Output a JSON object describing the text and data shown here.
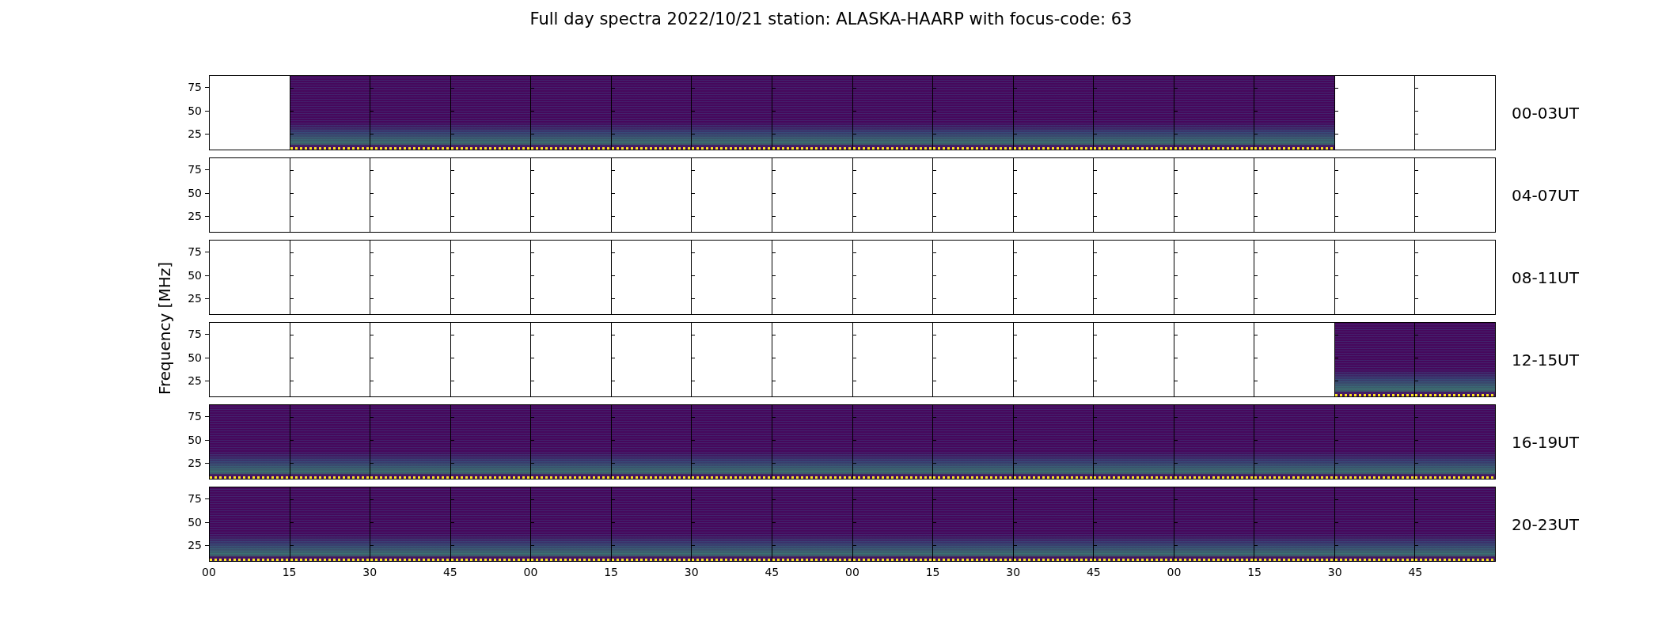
{
  "title": "Full day spectra 2022/10/21 station: ALASKA-HAARP with focus-code: 63",
  "ylabel": "Frequency [MHz]",
  "rows": [
    {
      "label": "00-03UT",
      "yticks": [
        "75",
        "50",
        "25"
      ],
      "panels": [
        false,
        true,
        true,
        true,
        true,
        true,
        true,
        true,
        true,
        true,
        true,
        true,
        true,
        true,
        false,
        false
      ]
    },
    {
      "label": "04-07UT",
      "yticks": [
        "75",
        "50",
        "25"
      ],
      "panels": [
        false,
        false,
        false,
        false,
        false,
        false,
        false,
        false,
        false,
        false,
        false,
        false,
        false,
        false,
        false,
        false
      ]
    },
    {
      "label": "08-11UT",
      "yticks": [
        "75",
        "50",
        "25"
      ],
      "panels": [
        false,
        false,
        false,
        false,
        false,
        false,
        false,
        false,
        false,
        false,
        false,
        false,
        false,
        false,
        false,
        false
      ]
    },
    {
      "label": "12-15UT",
      "yticks": [
        "75",
        "50",
        "25"
      ],
      "panels": [
        false,
        false,
        false,
        false,
        false,
        false,
        false,
        false,
        false,
        false,
        false,
        false,
        false,
        false,
        true,
        true
      ]
    },
    {
      "label": "16-19UT",
      "yticks": [
        "75",
        "50",
        "25"
      ],
      "panels": [
        true,
        true,
        true,
        true,
        true,
        true,
        true,
        true,
        true,
        true,
        true,
        true,
        true,
        true,
        true,
        true
      ]
    },
    {
      "label": "20-23UT",
      "yticks": [
        "75",
        "50",
        "25"
      ],
      "panels": [
        true,
        true,
        true,
        true,
        true,
        true,
        true,
        true,
        true,
        true,
        true,
        true,
        true,
        true,
        true,
        true
      ]
    }
  ],
  "xticks": [
    "00",
    "15",
    "30",
    "45",
    "00",
    "15",
    "30",
    "45",
    "00",
    "15",
    "30",
    "45",
    "00",
    "15",
    "30",
    "45"
  ]
}
